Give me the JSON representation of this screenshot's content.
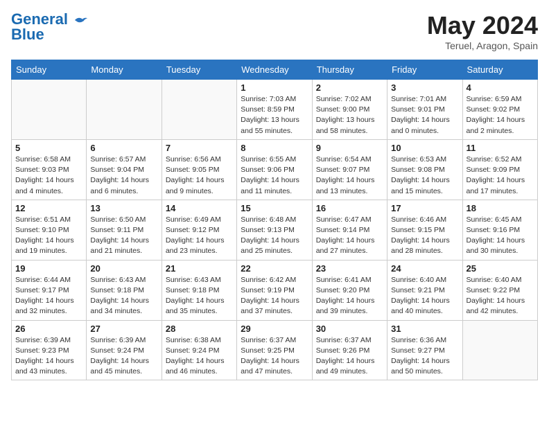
{
  "header": {
    "logo_line1": "General",
    "logo_line2": "Blue",
    "month_year": "May 2024",
    "location": "Teruel, Aragon, Spain"
  },
  "weekdays": [
    "Sunday",
    "Monday",
    "Tuesday",
    "Wednesday",
    "Thursday",
    "Friday",
    "Saturday"
  ],
  "weeks": [
    [
      {
        "day": "",
        "info": ""
      },
      {
        "day": "",
        "info": ""
      },
      {
        "day": "",
        "info": ""
      },
      {
        "day": "1",
        "info": "Sunrise: 7:03 AM\nSunset: 8:59 PM\nDaylight: 13 hours\nand 55 minutes."
      },
      {
        "day": "2",
        "info": "Sunrise: 7:02 AM\nSunset: 9:00 PM\nDaylight: 13 hours\nand 58 minutes."
      },
      {
        "day": "3",
        "info": "Sunrise: 7:01 AM\nSunset: 9:01 PM\nDaylight: 14 hours\nand 0 minutes."
      },
      {
        "day": "4",
        "info": "Sunrise: 6:59 AM\nSunset: 9:02 PM\nDaylight: 14 hours\nand 2 minutes."
      }
    ],
    [
      {
        "day": "5",
        "info": "Sunrise: 6:58 AM\nSunset: 9:03 PM\nDaylight: 14 hours\nand 4 minutes."
      },
      {
        "day": "6",
        "info": "Sunrise: 6:57 AM\nSunset: 9:04 PM\nDaylight: 14 hours\nand 6 minutes."
      },
      {
        "day": "7",
        "info": "Sunrise: 6:56 AM\nSunset: 9:05 PM\nDaylight: 14 hours\nand 9 minutes."
      },
      {
        "day": "8",
        "info": "Sunrise: 6:55 AM\nSunset: 9:06 PM\nDaylight: 14 hours\nand 11 minutes."
      },
      {
        "day": "9",
        "info": "Sunrise: 6:54 AM\nSunset: 9:07 PM\nDaylight: 14 hours\nand 13 minutes."
      },
      {
        "day": "10",
        "info": "Sunrise: 6:53 AM\nSunset: 9:08 PM\nDaylight: 14 hours\nand 15 minutes."
      },
      {
        "day": "11",
        "info": "Sunrise: 6:52 AM\nSunset: 9:09 PM\nDaylight: 14 hours\nand 17 minutes."
      }
    ],
    [
      {
        "day": "12",
        "info": "Sunrise: 6:51 AM\nSunset: 9:10 PM\nDaylight: 14 hours\nand 19 minutes."
      },
      {
        "day": "13",
        "info": "Sunrise: 6:50 AM\nSunset: 9:11 PM\nDaylight: 14 hours\nand 21 minutes."
      },
      {
        "day": "14",
        "info": "Sunrise: 6:49 AM\nSunset: 9:12 PM\nDaylight: 14 hours\nand 23 minutes."
      },
      {
        "day": "15",
        "info": "Sunrise: 6:48 AM\nSunset: 9:13 PM\nDaylight: 14 hours\nand 25 minutes."
      },
      {
        "day": "16",
        "info": "Sunrise: 6:47 AM\nSunset: 9:14 PM\nDaylight: 14 hours\nand 27 minutes."
      },
      {
        "day": "17",
        "info": "Sunrise: 6:46 AM\nSunset: 9:15 PM\nDaylight: 14 hours\nand 28 minutes."
      },
      {
        "day": "18",
        "info": "Sunrise: 6:45 AM\nSunset: 9:16 PM\nDaylight: 14 hours\nand 30 minutes."
      }
    ],
    [
      {
        "day": "19",
        "info": "Sunrise: 6:44 AM\nSunset: 9:17 PM\nDaylight: 14 hours\nand 32 minutes."
      },
      {
        "day": "20",
        "info": "Sunrise: 6:43 AM\nSunset: 9:18 PM\nDaylight: 14 hours\nand 34 minutes."
      },
      {
        "day": "21",
        "info": "Sunrise: 6:43 AM\nSunset: 9:18 PM\nDaylight: 14 hours\nand 35 minutes."
      },
      {
        "day": "22",
        "info": "Sunrise: 6:42 AM\nSunset: 9:19 PM\nDaylight: 14 hours\nand 37 minutes."
      },
      {
        "day": "23",
        "info": "Sunrise: 6:41 AM\nSunset: 9:20 PM\nDaylight: 14 hours\nand 39 minutes."
      },
      {
        "day": "24",
        "info": "Sunrise: 6:40 AM\nSunset: 9:21 PM\nDaylight: 14 hours\nand 40 minutes."
      },
      {
        "day": "25",
        "info": "Sunrise: 6:40 AM\nSunset: 9:22 PM\nDaylight: 14 hours\nand 42 minutes."
      }
    ],
    [
      {
        "day": "26",
        "info": "Sunrise: 6:39 AM\nSunset: 9:23 PM\nDaylight: 14 hours\nand 43 minutes."
      },
      {
        "day": "27",
        "info": "Sunrise: 6:39 AM\nSunset: 9:24 PM\nDaylight: 14 hours\nand 45 minutes."
      },
      {
        "day": "28",
        "info": "Sunrise: 6:38 AM\nSunset: 9:24 PM\nDaylight: 14 hours\nand 46 minutes."
      },
      {
        "day": "29",
        "info": "Sunrise: 6:37 AM\nSunset: 9:25 PM\nDaylight: 14 hours\nand 47 minutes."
      },
      {
        "day": "30",
        "info": "Sunrise: 6:37 AM\nSunset: 9:26 PM\nDaylight: 14 hours\nand 49 minutes."
      },
      {
        "day": "31",
        "info": "Sunrise: 6:36 AM\nSunset: 9:27 PM\nDaylight: 14 hours\nand 50 minutes."
      },
      {
        "day": "",
        "info": ""
      }
    ]
  ]
}
